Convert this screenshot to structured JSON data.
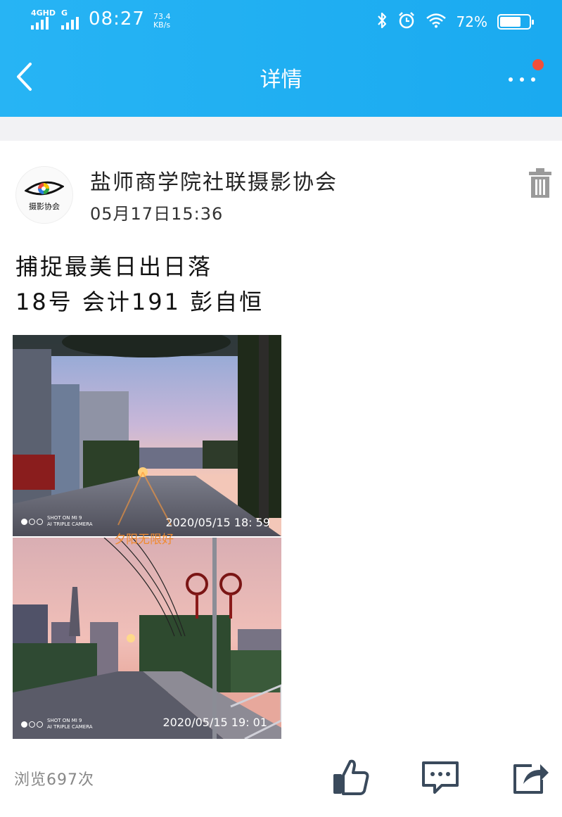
{
  "status_bar": {
    "signal1_tag": "4GHD",
    "signal2_tag": "G",
    "time": "08:27",
    "net_speed": "73.4",
    "net_unit": "KB/s",
    "battery_pct": "72%",
    "battery_level": 0.72
  },
  "nav": {
    "title": "详情"
  },
  "post": {
    "author": "盐师商学院社联摄影协会",
    "time": "05月17日15:36",
    "avatar_text": "摄影协会",
    "content_line1": "捕捉最美日出日落",
    "content_line2": "18号  会计191  彭自恒"
  },
  "photos": [
    {
      "timestamp": "2020/05/15  18: 59",
      "shot_line1": "SHOT ON MI 9",
      "shot_line2": "AI TRIPLE CAMERA"
    },
    {
      "timestamp": "2020/05/15  19: 01",
      "shot_line1": "SHOT ON MI 9",
      "shot_line2": "AI TRIPLE CAMERA"
    }
  ],
  "overlay_text": "夕阳无限好",
  "footer": {
    "views": "浏览697次"
  },
  "colors": {
    "header": "#1aaaf0",
    "badge": "#f04f3a",
    "icon": "#3a4a5c"
  }
}
